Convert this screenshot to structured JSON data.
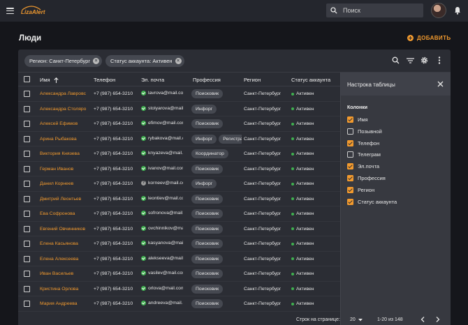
{
  "app": {
    "logo_text": "LizaAlert"
  },
  "search": {
    "placeholder": "Поиск"
  },
  "page": {
    "title": "Люди",
    "add_label": "ДОБАВИТЬ"
  },
  "filters": [
    {
      "label": "Регион: Санкт-Петербург"
    },
    {
      "label": "Статус аккаунта: Активен"
    }
  ],
  "columns": {
    "name": "Имя",
    "phone": "Телефон",
    "email": "Эл. почта",
    "profession": "Профессия",
    "region": "Регион",
    "status": "Статус аккаунта"
  },
  "rows": [
    {
      "name": "Александра Лавровс",
      "phone": "+7 (987) 654-3210",
      "email": "lavrova@mail.com",
      "email_status": "verified",
      "professions": [
        "Поисковик"
      ],
      "region": "Санкт-Петербург",
      "status": "Активен"
    },
    {
      "name": "Александра Столяро",
      "phone": "+7 (987) 654-3210",
      "email": "stolyarova@mail.com",
      "email_status": "verified",
      "professions": [
        "Инфорг"
      ],
      "region": "Санкт-Петербург",
      "status": "Активен"
    },
    {
      "name": "Алексей Ефимов",
      "phone": "+7 (987) 654-3210",
      "email": "efimov@mail.com",
      "email_status": "verified",
      "professions": [
        "Поисковик"
      ],
      "region": "Санкт-Петербург",
      "status": "Активен"
    },
    {
      "name": "Арина Рыбакова",
      "phone": "+7 (987) 654-3210",
      "email": "rybakova@mail.com",
      "email_status": "verified",
      "professions": [
        "Инфорг",
        "Регистратор"
      ],
      "region": "Санкт-Петербург",
      "status": "Активен"
    },
    {
      "name": "Виктория Князева",
      "phone": "+7 (987) 654-3210",
      "email": "knyazeva@mail.com",
      "email_status": "verified",
      "professions": [
        "Координатор"
      ],
      "region": "Санкт-Петербург",
      "status": "Активен"
    },
    {
      "name": "Герман Иванов",
      "phone": "+7 (987) 654-3210",
      "email": "ivanov@mail.com",
      "email_status": "verified",
      "professions": [
        "Поисковик"
      ],
      "region": "Санкт-Петербург",
      "status": "Активен"
    },
    {
      "name": "Данил Корнеев",
      "phone": "+7 (987) 654-3210",
      "email": "korneev@mail.com",
      "email_status": "unknown",
      "professions": [
        "Инфорг"
      ],
      "region": "Санкт-Петербург",
      "status": "Активен"
    },
    {
      "name": "Дмитрий Леонтьев",
      "phone": "+7 (987) 654-3210",
      "email": "leontiev@mail.com",
      "email_status": "verified",
      "professions": [
        "Поисковик"
      ],
      "region": "Санкт-Петербург",
      "status": "Активен"
    },
    {
      "name": "Ева Софронова",
      "phone": "+7 (987) 654-3210",
      "email": "sofronova@mail.com",
      "email_status": "verified",
      "professions": [
        "Поисковик"
      ],
      "region": "Санкт-Петербург",
      "status": "Активен"
    },
    {
      "name": "Евгений Овчинников",
      "phone": "+7 (987) 654-3210",
      "email": "ovchinnikov@mail.com",
      "email_status": "verified",
      "professions": [
        "Поисковик"
      ],
      "region": "Санкт-Петербург",
      "status": "Активен"
    },
    {
      "name": "Елена Касьянова",
      "phone": "+7 (987) 654-3210",
      "email": "kasyanova@mail.com",
      "email_status": "verified",
      "professions": [
        "Поисковик"
      ],
      "region": "Санкт-Петербург",
      "status": "Активен"
    },
    {
      "name": "Елена Алексеева",
      "phone": "+7 (987) 654-3210",
      "email": "alekseeva@mail.com",
      "email_status": "verified",
      "professions": [
        "Поисковик"
      ],
      "region": "Санкт-Петербург",
      "status": "Активен"
    },
    {
      "name": "Иван Васильев",
      "phone": "+7 (987) 654-3210",
      "email": "vasilev@mail.com",
      "email_status": "verified",
      "professions": [
        "Поисковик"
      ],
      "region": "Санкт-Петербург",
      "status": "Активен"
    },
    {
      "name": "Кристина Орлова",
      "phone": "+7 (987) 654-3210",
      "email": "orlova@mail.com",
      "email_status": "verified",
      "professions": [
        "Поисковик"
      ],
      "region": "Санкт-Петербург",
      "status": "Активен"
    },
    {
      "name": "Мария Андреева",
      "phone": "+7 (987) 654-3210",
      "email": "andreeva@mail.com",
      "email_status": "verified",
      "professions": [
        "Поисковик"
      ],
      "region": "Санкт-Петербург",
      "status": "Активен"
    }
  ],
  "settings": {
    "title": "Настрока таблицы",
    "columns_label": "Колонки",
    "options": [
      {
        "label": "Имя",
        "checked": true
      },
      {
        "label": "Позывной",
        "checked": false
      },
      {
        "label": "Телефон",
        "checked": true
      },
      {
        "label": "Телеграм",
        "checked": false
      },
      {
        "label": "Эл.почта",
        "checked": true
      },
      {
        "label": "Профессия",
        "checked": true
      },
      {
        "label": "Регион",
        "checked": true
      },
      {
        "label": "Статус аккаунта",
        "checked": true
      }
    ]
  },
  "pagination": {
    "rows_per_page_label": "Строк на странице:",
    "rows_per_page": "20",
    "range": "1-20 из 148"
  },
  "colors": {
    "accent": "#f29a2e",
    "success": "#3fb04f",
    "background": "#15161b",
    "panel": "#2b2d34"
  }
}
